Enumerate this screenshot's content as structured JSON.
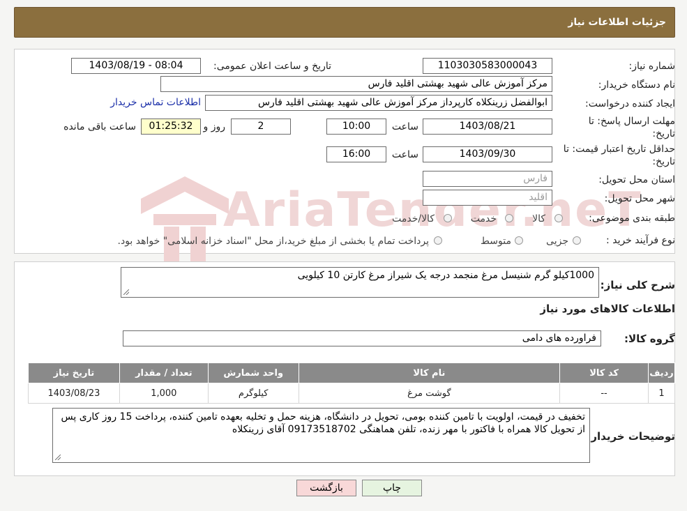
{
  "header": {
    "title": "جزئیات اطلاعات نیاز"
  },
  "form": {
    "need_number_label": "شماره نیاز:",
    "need_number_value": "1103030583000043",
    "announce_label": "تاریخ و ساعت اعلان عمومی:",
    "announce_value": "1403/08/19 - 08:04",
    "buyer_org_label": "نام دستگاه خریدار:",
    "buyer_org_value": "مرکز آموزش عالی شهید بهشتی اقلید فارس",
    "creator_label": "ایجاد کننده درخواست:",
    "creator_value": "ابوالفضل زرینکلاه کارپرداز مرکز آموزش عالی شهید بهشتی اقلید فارس",
    "contact_link": "اطلاعات تماس خریدار",
    "deadline_label_1": "مهلت ارسال پاسخ: تا",
    "deadline_label_2": "تاریخ:",
    "deadline_date": "1403/08/21",
    "time_label": "ساعت",
    "deadline_time": "10:00",
    "days_value": "2",
    "days_label": "روز و",
    "remaining_value": "01:25:32",
    "remaining_label": "ساعت باقی مانده",
    "validity_label_1": "حداقل تاریخ اعتبار قیمت: تا",
    "validity_label_2": "تاریخ:",
    "validity_date": "1403/09/30",
    "validity_time": "16:00",
    "province_label": "استان محل تحویل:",
    "province_value": "فارس",
    "city_label": "شهر محل تحویل:",
    "city_value": "اقلید",
    "category_label": "طبقه بندی موضوعی:",
    "category_options": [
      "کالا",
      "خدمت",
      "کالا/خدمت"
    ],
    "process_label": "نوع فرآیند خرید :",
    "process_options": [
      "جزیی",
      "متوسط"
    ],
    "process_note": "پرداخت تمام یا بخشی از مبلغ خرید،از محل \"اسناد خزانه اسلامی\" خواهد بود."
  },
  "details": {
    "description_label": "شرح کلی نیاز:",
    "description_value": "1000کیلو گرم شنیسل مرغ منجمد درجه یک شیراز مرغ کارتن 10 کیلویی",
    "goods_info_title": "اطلاعات کالاهای مورد نیاز",
    "goods_group_label": "گروه کالا:",
    "goods_group_value": "فراورده های دامی",
    "table": {
      "headers": [
        "ردیف",
        "کد کالا",
        "نام کالا",
        "واحد شمارش",
        "تعداد / مقدار",
        "تاریخ نیاز"
      ],
      "rows": [
        [
          "1",
          "--",
          "گوشت مرغ",
          "کیلوگرم",
          "1,000",
          "1403/08/23"
        ]
      ]
    },
    "buyer_notes_label": "توضیحات خریدار:",
    "buyer_notes_value": "تخفیف در قیمت، اولویت با تامین کننده بومی، تحویل در دانشگاه، هزینه حمل و تخلیه بعهده تامین کننده، پرداخت 15 روز کاری پس از تحویل کالا همراه با فاکتور با مهر زنده، تلفن هماهنگی 09173518702 آقای زرینکلاه"
  },
  "buttons": {
    "print": "چاپ",
    "back": "بازگشت"
  },
  "watermark": {
    "text": "AriaTender.neT"
  },
  "colors": {
    "header": "#8b6f3e",
    "remaining_bg": "#ffffcc",
    "back_btn": "#f8d8d8",
    "print_btn": "#e6f4e0",
    "table_head": "#8a8a8a"
  }
}
